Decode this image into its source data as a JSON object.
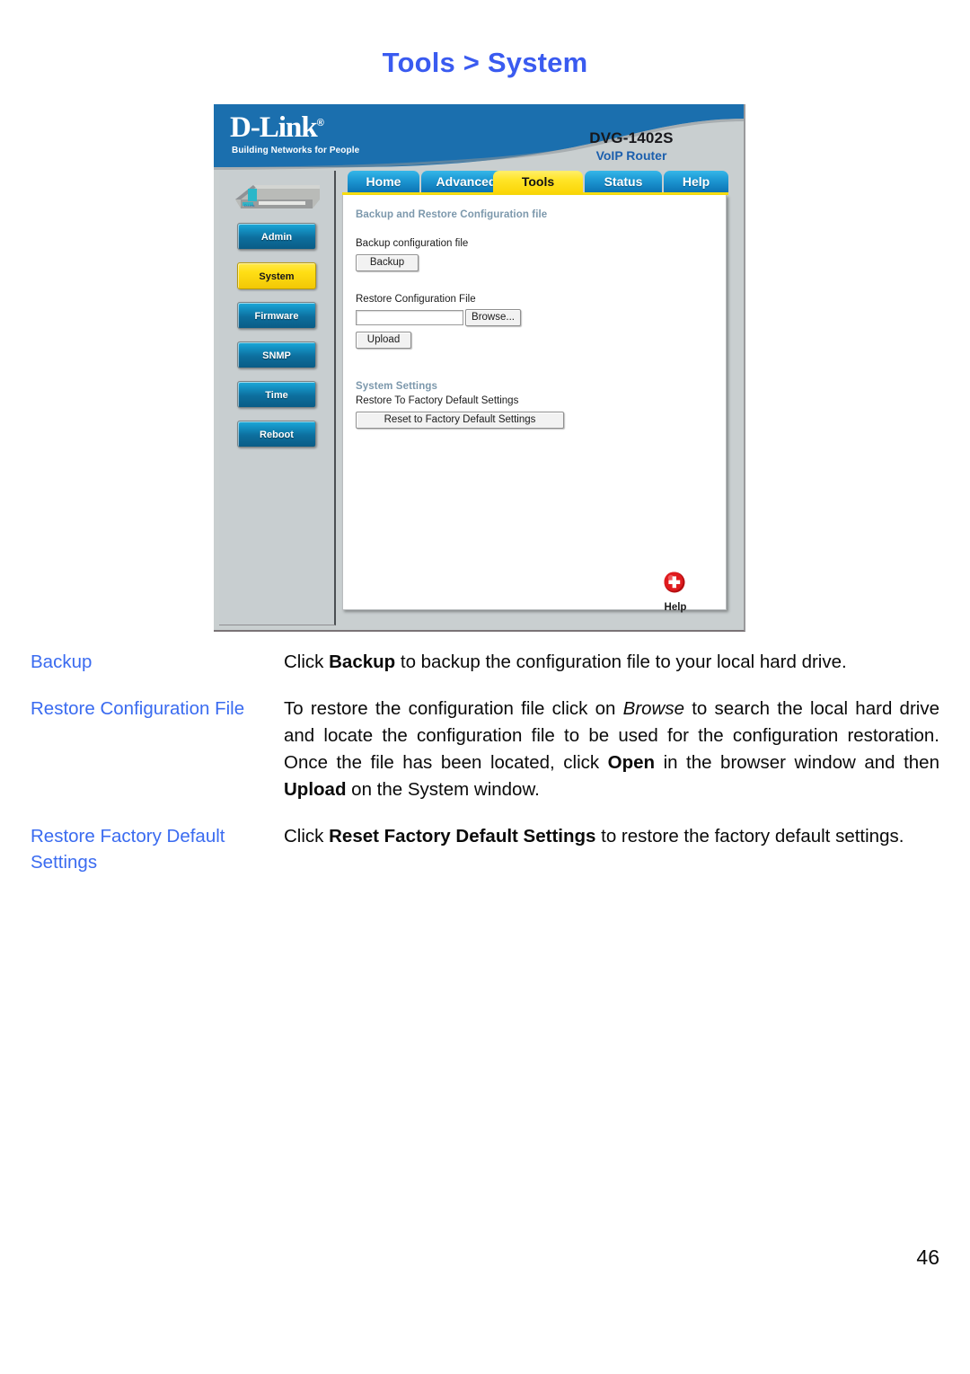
{
  "page": {
    "title": "Tools > System",
    "number": "46"
  },
  "device_ui": {
    "brand": {
      "logo": "D-Link",
      "registered_mark": "®",
      "tagline": "Building Networks for People",
      "model": "DVG-1402S",
      "model_subtitle": "VoIP Router"
    },
    "sidebar": {
      "items": [
        {
          "label": "Admin",
          "active": false
        },
        {
          "label": "System",
          "active": true
        },
        {
          "label": "Firmware",
          "active": false
        },
        {
          "label": "SNMP",
          "active": false
        },
        {
          "label": "Time",
          "active": false
        },
        {
          "label": "Reboot",
          "active": false
        }
      ]
    },
    "tabs": [
      {
        "label": "Home",
        "selected": false
      },
      {
        "label": "Advanced",
        "selected": false
      },
      {
        "label": "Tools",
        "selected": true
      },
      {
        "label": "Status",
        "selected": false
      },
      {
        "label": "Help",
        "selected": false
      }
    ],
    "sections": {
      "backup_restore": {
        "heading": "Backup and Restore Configuration file",
        "backup_label": "Backup configuration file",
        "backup_button": "Backup",
        "restore_label": "Restore Configuration File",
        "restore_input_value": "",
        "browse_button": "Browse...",
        "upload_button": "Upload"
      },
      "system_settings": {
        "heading": "System Settings",
        "restore_label": "Restore To Factory Default Settings",
        "reset_button": "Reset to Factory Default Settings"
      }
    },
    "help": {
      "label": "Help",
      "icon": "help-plus-icon"
    },
    "colors": {
      "banner_blue": "#1b6fae",
      "tab_blue": "#1f9bd6",
      "tab_selected_yellow": "#ffe426",
      "panel_gray": "#c9cfd0",
      "section_head": "#7c98ac"
    }
  },
  "descriptions": [
    {
      "term": "Backup",
      "parts": [
        {
          "t": "Click ",
          "s": "n"
        },
        {
          "t": "Backup",
          "s": "b"
        },
        {
          "t": " to backup the configuration file to your local hard drive.",
          "s": "n"
        }
      ]
    },
    {
      "term": "Restore Configuration File",
      "parts": [
        {
          "t": "To restore the configuration file click on ",
          "s": "n"
        },
        {
          "t": "Browse",
          "s": "i"
        },
        {
          "t": " to search the local hard drive and locate the configuration file to be used for the configuration restoration. Once the file has been located, click ",
          "s": "n"
        },
        {
          "t": "Open",
          "s": "b"
        },
        {
          "t": " in the browser window and then ",
          "s": "n"
        },
        {
          "t": "Upload",
          "s": "b"
        },
        {
          "t": " on the System window.",
          "s": "n"
        }
      ]
    },
    {
      "term": "Restore Factory Default Settings",
      "parts": [
        {
          "t": "Click ",
          "s": "n"
        },
        {
          "t": "Reset Factory Default Settings",
          "s": "b"
        },
        {
          "t": " to restore the factory default settings.",
          "s": "n"
        }
      ]
    }
  ],
  "colors": {
    "heading_blue": "#3a5bf0",
    "term_blue": "#3a6bf0",
    "body_black": "#0a0a0a"
  }
}
